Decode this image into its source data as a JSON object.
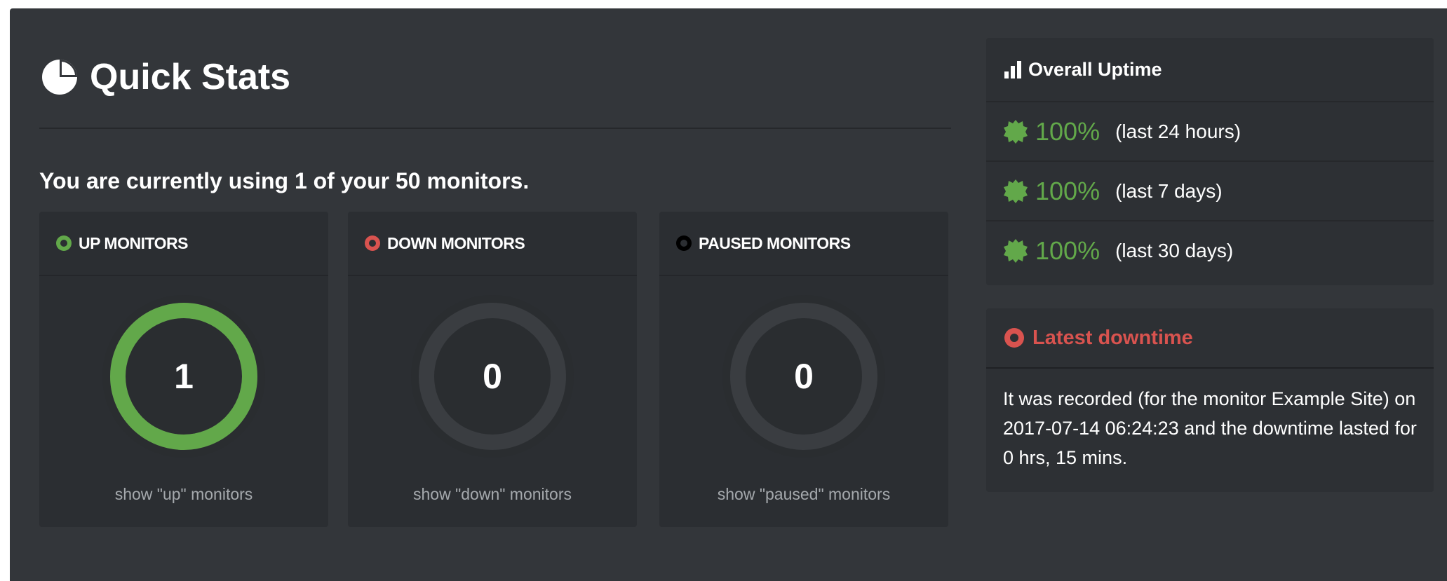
{
  "quick_stats": {
    "title": "Quick Stats",
    "title_icon": "pie-chart-icon",
    "usage_text": "You are currently using 1 of your 50 monitors."
  },
  "cards": [
    {
      "id": "up",
      "label": "UP MONITORS",
      "status_color": "#62a84a",
      "value": "1",
      "fraction": 1,
      "link": "show \"up\" monitors"
    },
    {
      "id": "down",
      "label": "DOWN MONITORS",
      "status_color": "#d9534f",
      "value": "0",
      "fraction": 0,
      "link": "show \"down\" monitors"
    },
    {
      "id": "paused",
      "label": "PAUSED MONITORS",
      "status_color": "#000000",
      "value": "0",
      "fraction": 0,
      "link": "show \"paused\" monitors"
    }
  ],
  "overall_uptime": {
    "title": "Overall Uptime",
    "title_icon": "bar-chart-icon",
    "rows": [
      {
        "percent": "100%",
        "period": "(last 24 hours)",
        "icon": "seal-badge-icon"
      },
      {
        "percent": "100%",
        "period": "(last 7 days)",
        "icon": "seal-badge-icon"
      },
      {
        "percent": "100%",
        "period": "(last 30 days)",
        "icon": "seal-badge-icon"
      }
    ]
  },
  "latest_downtime": {
    "title": "Latest downtime",
    "title_icon": "alert-circle-icon",
    "text": "It was recorded (for the monitor Example Site) on 2017-07-14 06:24:23 and the downtime lasted for 0 hrs, 15 mins."
  },
  "colors": {
    "up": "#62a84a",
    "down": "#d9534f",
    "paused": "#000000",
    "gauge_track": "#3a3d41"
  }
}
